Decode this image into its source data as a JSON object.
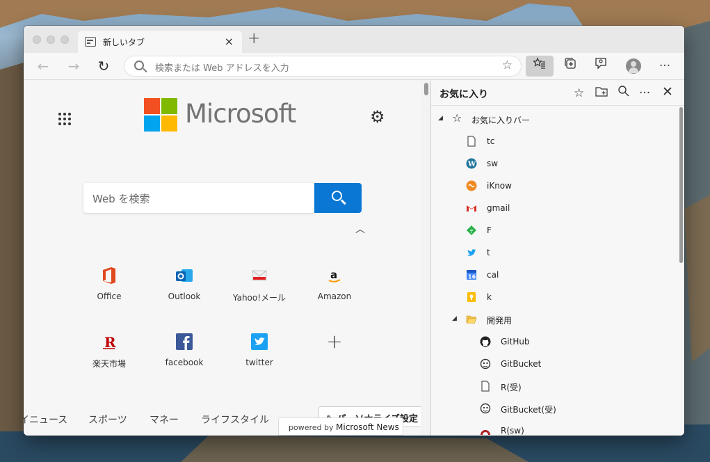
{
  "tab": {
    "title": "新しいタブ",
    "close": "×",
    "new_tab": "+"
  },
  "toolbar": {
    "back": "←",
    "forward": "→",
    "refresh": "↻",
    "address_placeholder": "検索または Web アドレスを入力",
    "more": "···"
  },
  "ntp": {
    "brand": "Microsoft",
    "search_placeholder": "Web を検索",
    "quick_links": [
      {
        "label": "Office"
      },
      {
        "label": "Outlook"
      },
      {
        "label": "Yahoo!メール"
      },
      {
        "label": "Amazon"
      },
      {
        "label": "楽天市場"
      },
      {
        "label": "facebook"
      },
      {
        "label": "twitter"
      },
      {
        "label": "+"
      }
    ],
    "news_tabs": [
      "イニュース",
      "スポーツ",
      "マネー",
      "ライフスタイル"
    ],
    "personalize": "パーソナライズ設定",
    "powered_prefix": "powered by",
    "powered_brand": "Microsoft News"
  },
  "favorites": {
    "title": "お気に入り",
    "root": "お気に入りバー",
    "items": [
      {
        "label": "tc",
        "icon": "page-icon"
      },
      {
        "label": "sw",
        "icon": "wordpress-icon"
      },
      {
        "label": "iKnow",
        "icon": "iknow-icon"
      },
      {
        "label": "gmail",
        "icon": "gmail-icon"
      },
      {
        "label": "F",
        "icon": "feedly-icon"
      },
      {
        "label": "t",
        "icon": "twitter-icon"
      },
      {
        "label": "cal",
        "icon": "calendar-icon"
      },
      {
        "label": "k",
        "icon": "keep-icon"
      }
    ],
    "folder": "開発用",
    "folder_items": [
      {
        "label": "GitHub",
        "icon": "github-icon"
      },
      {
        "label": "GitBucket",
        "icon": "gitbucket-icon"
      },
      {
        "label": "R(受)",
        "icon": "page-icon"
      },
      {
        "label": "GitBucket(受)",
        "icon": "gitbucket-icon"
      },
      {
        "label": "R(sw)",
        "icon": "redmine-icon"
      }
    ]
  },
  "colors": {
    "accent": "#0a77d5",
    "ms_red": "#f25022",
    "ms_green": "#7fba00",
    "ms_blue": "#00a4ef",
    "ms_yellow": "#ffb900"
  }
}
